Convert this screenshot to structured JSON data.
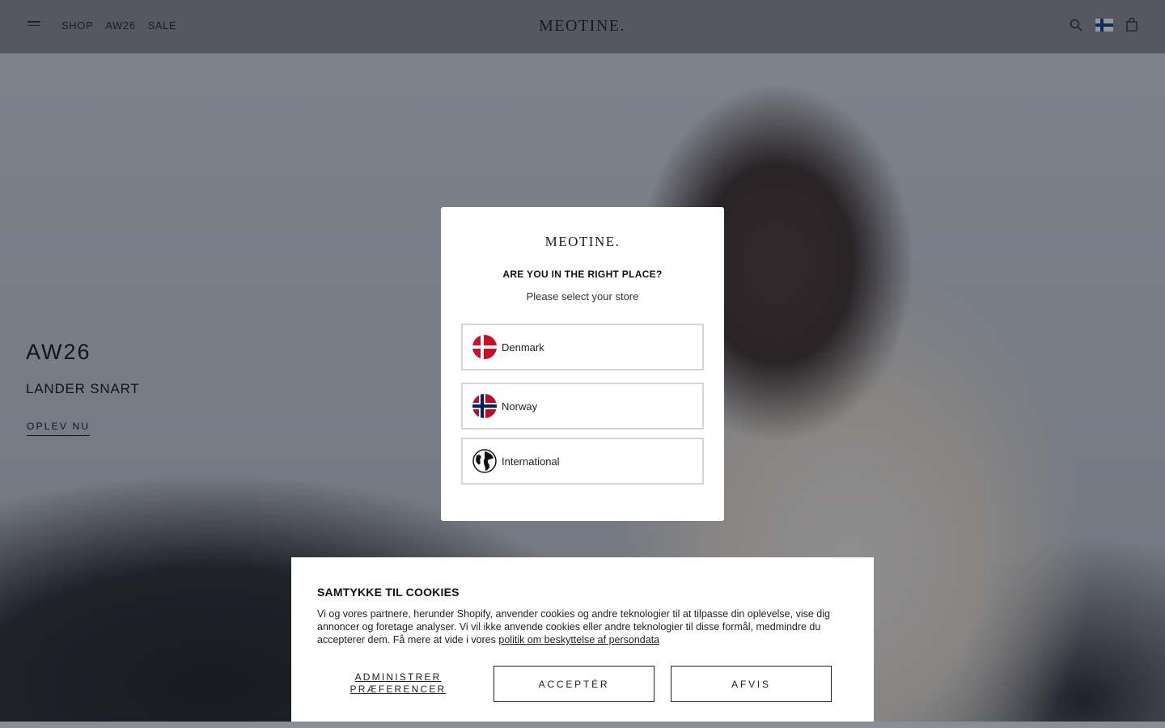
{
  "header": {
    "logo": "MEOTINE.",
    "nav": [
      "SHOP",
      "AW26",
      "SALE"
    ]
  },
  "hero": {
    "title": "AW26",
    "subtitle": "LANDER SNART",
    "cta": "OPLEV NU"
  },
  "store_modal": {
    "logo": "MEOTINE.",
    "title": "ARE YOU IN THE RIGHT PLACE?",
    "subtitle": "Please select your store",
    "stores": [
      {
        "label": "Denmark",
        "icon": "denmark-flag-icon"
      },
      {
        "label": "Norway",
        "icon": "norway-flag-icon"
      },
      {
        "label": "International",
        "icon": "globe-icon"
      }
    ]
  },
  "cookie_banner": {
    "title": "SAMTYKKE TIL COOKIES",
    "text": "Vi og vores partnere, herunder Shopify, anvender cookies og andre teknologier til at tilpasse din oplevelse, vise dig annoncer og foretage analyser. Vi vil ikke anvende cookies eller andre teknologier til disse formål, medmindre du accepterer dem. Få mere at vide i vores ",
    "link": "politik om beskyttelse af persondata",
    "manage": "ADMINISTRER PRÆFERENCER",
    "accept": "ACCEPTÉR",
    "reject": "AFVIS"
  },
  "colors": {
    "overlay": "#1a1f2e",
    "finland_blue": "#0b3d8f",
    "denmark_red": "#c8102e",
    "norway_red": "#ba0c2f",
    "norway_blue": "#00205b"
  }
}
